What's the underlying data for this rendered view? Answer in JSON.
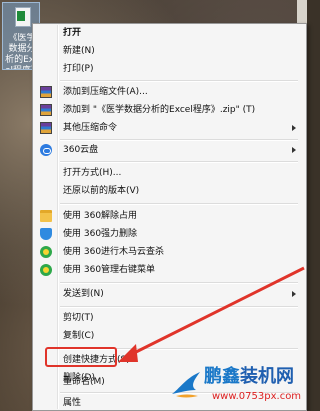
{
  "desktop_icon": {
    "caption": "《医学数据分析的Excel程序》"
  },
  "menu": {
    "items": [
      {
        "label": "打开",
        "bold": true
      },
      {
        "label": "新建(N)"
      },
      {
        "label": "打印(P)"
      },
      {
        "label": "添加到压缩文件(A)...",
        "icon": "winrar-icon"
      },
      {
        "label": "添加到 \"《医学数据分析的Excel程序》.zip\" (T)",
        "icon": "winrar-icon"
      },
      {
        "label": "其他压缩命令",
        "icon": "winrar-icon",
        "submenu": true
      },
      {
        "label": "360云盘",
        "icon": "cloud-icon",
        "submenu": true
      },
      {
        "label": "打开方式(H)..."
      },
      {
        "label": "还原以前的版本(V)"
      },
      {
        "label": "使用 360解除占用",
        "icon": "folder-icon"
      },
      {
        "label": "使用 360强力删除",
        "icon": "shield-icon"
      },
      {
        "label": "使用 360进行木马云查杀",
        "icon": "green-icon"
      },
      {
        "label": "使用 360管理右键菜单",
        "icon": "green-icon"
      },
      {
        "label": "发送到(N)",
        "submenu": true
      },
      {
        "label": "剪切(T)"
      },
      {
        "label": "复制(C)"
      },
      {
        "label": "创建快捷方式(S)"
      },
      {
        "label": "删除(D)"
      },
      {
        "label": "重命名(M)"
      },
      {
        "label": "属性"
      }
    ]
  },
  "watermark": {
    "title_part1": "鹏鑫",
    "title_part2": "装机网",
    "url": "www.0753px.com"
  },
  "colors": {
    "highlight": "#e0342a",
    "arrow": "#e0342a"
  }
}
